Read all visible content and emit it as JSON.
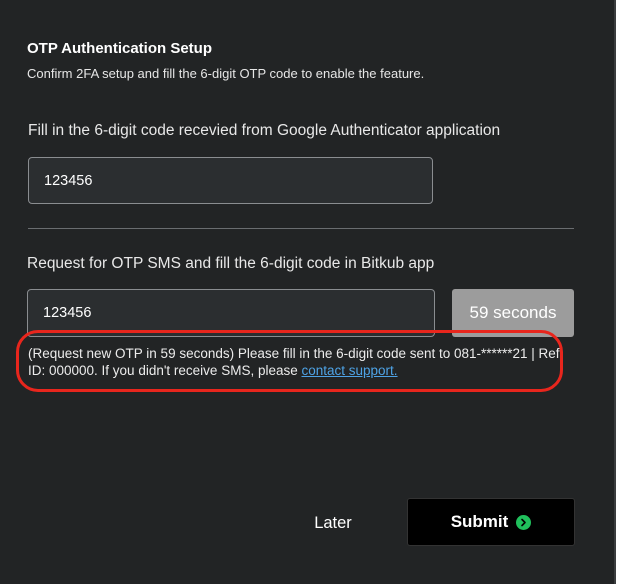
{
  "header": {
    "title": "OTP Authentication Setup",
    "subtitle": "Confirm 2FA setup and fill the 6-digit OTP code to enable the feature."
  },
  "google_auth": {
    "label": "Fill in the 6-digit code recevied from Google Authenticator application",
    "value": "123456"
  },
  "sms": {
    "label": "Request for OTP SMS and fill the 6-digit code in Bitkub app",
    "value": "123456",
    "countdown": "59 seconds",
    "hint_text": "(Request new OTP in 59 seconds) Please fill in the 6-digit code sent to 081-******21 | Ref ID: 000000. If you didn't receive SMS, please ",
    "contact_link": "contact support."
  },
  "actions": {
    "later_label": "Later",
    "submit_label": "Submit"
  },
  "icons": {
    "submit_arrow": "arrow-right-circle-icon"
  },
  "colors": {
    "background": "#222425",
    "highlight": "#e8261d",
    "link": "#4ea3e6",
    "submit_icon": "#20c05c",
    "countdown_bg": "#9c9c9c"
  }
}
